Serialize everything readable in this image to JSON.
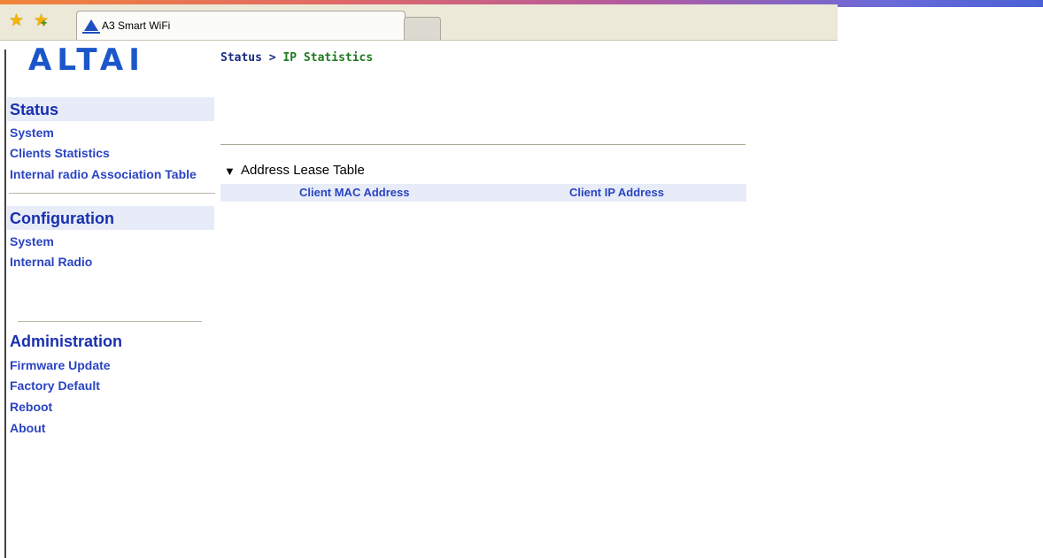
{
  "browser": {
    "tab_title": "A3 Smart WiFi"
  },
  "logo": {
    "text": "ALTAI"
  },
  "breadcrumb": {
    "parent": "Status",
    "separator": ">",
    "current": "IP Statistics"
  },
  "sidebar": {
    "status": {
      "title": "Status",
      "items": [
        "System",
        "Clients Statistics",
        "Internal radio Association Table"
      ]
    },
    "configuration": {
      "title": "Configuration",
      "items": [
        "System",
        "Internal Radio"
      ]
    },
    "administration": {
      "title": "Administration",
      "items": [
        "Firmware Update",
        "Factory Default",
        "Reboot",
        "About"
      ]
    }
  },
  "lease_table": {
    "title": "Address Lease Table",
    "columns": [
      "Client MAC Address",
      "Client IP Address"
    ],
    "rows": []
  },
  "colors": {
    "link": "#2a44c2",
    "section_bg": "#e7ecf8",
    "brand": "#1b57c9"
  }
}
